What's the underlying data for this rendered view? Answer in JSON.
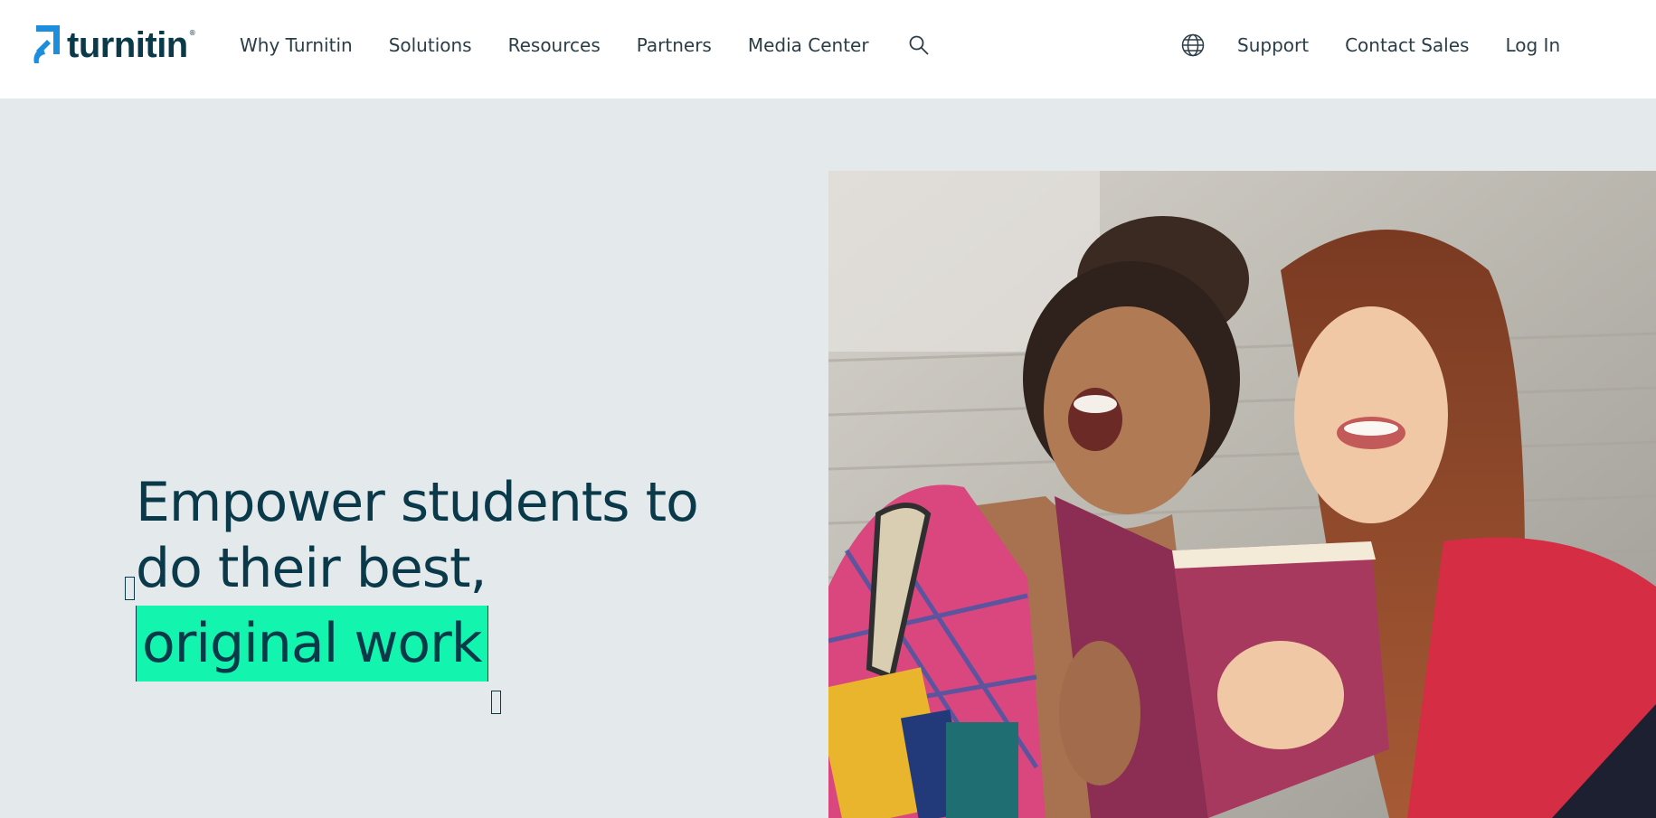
{
  "brand": {
    "name": "turnitin",
    "trademark": "®",
    "accent_color": "#1d8dde",
    "highlight_color": "#13f5ae",
    "text_color": "#0a3a4a"
  },
  "nav": {
    "left": [
      {
        "label": "Why Turnitin"
      },
      {
        "label": "Solutions"
      },
      {
        "label": "Resources"
      },
      {
        "label": "Partners"
      },
      {
        "label": "Media Center"
      }
    ],
    "search_icon": "search-icon",
    "globe_icon": "globe-icon",
    "right": [
      {
        "label": "Support"
      },
      {
        "label": "Contact Sales"
      },
      {
        "label": "Log In"
      }
    ]
  },
  "hero": {
    "line1": "Empower students to",
    "line2": "do their best,",
    "highlight": "original work",
    "image": "two-students-reading-book-photo"
  }
}
